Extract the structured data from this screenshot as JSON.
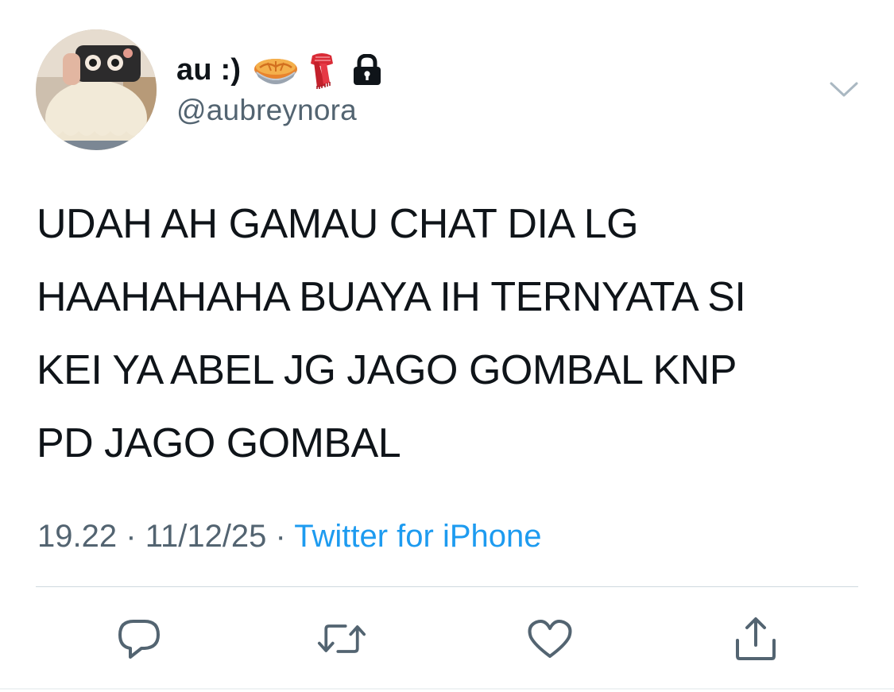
{
  "tweet": {
    "display_name": "au :)",
    "name_emojis": [
      "pie-emoji",
      "scarf-emoji",
      "lock-icon"
    ],
    "handle": "@aubreynora",
    "text": "UDAH AH GAMAU CHAT DIA LG\nHAAHAHAHA BUAYA IH TERNYATA SI\nKEI YA ABEL JG JAGO GOMBAL KNP\nPD JAGO GOMBAL",
    "time": "19.22",
    "separator": "·",
    "date": "11/12/25",
    "source": "Twitter for iPhone"
  },
  "icons": {
    "more": "chevron-down-icon",
    "reply": "reply-icon",
    "retweet": "retweet-icon",
    "like": "heart-icon",
    "share": "share-icon"
  },
  "colors": {
    "text_primary": "#0f1419",
    "text_secondary": "#536471",
    "link": "#1d9bf0",
    "divider": "#cfd9de",
    "icon": "#536471"
  }
}
